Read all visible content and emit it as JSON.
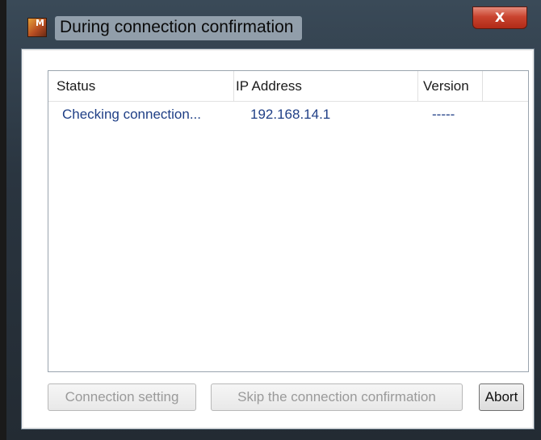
{
  "window": {
    "title": "During connection confirmation",
    "close_glyph": "X",
    "icon_letter": "M"
  },
  "list": {
    "columns": [
      "Status",
      "IP Address",
      "Version"
    ],
    "rows": [
      {
        "status": "Checking connection...",
        "ip": "192.168.14.1",
        "version": "-----"
      }
    ]
  },
  "buttons": {
    "connection_setting": "Connection setting",
    "skip": "Skip the connection confirmation",
    "abort": "Abort"
  },
  "colors": {
    "row_text": "#1f3f86",
    "disabled_text": "#9a9a9a",
    "close_button": "#c9442f"
  }
}
